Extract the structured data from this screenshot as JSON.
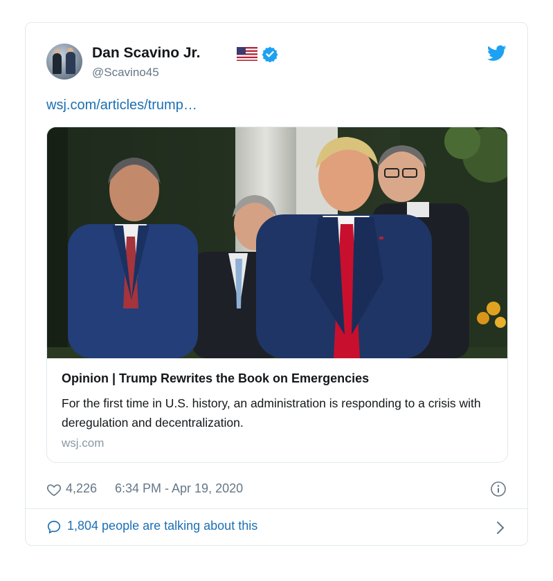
{
  "tweet": {
    "author": {
      "name": "Dan Scavino Jr.",
      "handle": "@Scavino45",
      "badges": [
        "us-flag-icon",
        "verified-icon"
      ]
    },
    "link_text": "wsj.com/articles/trump…",
    "card": {
      "title": "Opinion | Trump Rewrites the Book on Emergencies",
      "description": "For the first time in U.S. history, an administration is responding to a crisis with deregulation and decentralization.",
      "domain": "wsj.com"
    },
    "likes": "4,226",
    "timestamp": "6:34 PM - Apr 19, 2020",
    "talking": "1,804 people are talking about this"
  },
  "colors": {
    "link_blue": "#1b6fb4",
    "muted_gray": "#657786",
    "verified_blue": "#1da1f2",
    "twitter_blue": "#1da1f2",
    "border": "#e1e8ed",
    "tie_red": "#c8102e",
    "suit_navy": "#1f3566"
  }
}
